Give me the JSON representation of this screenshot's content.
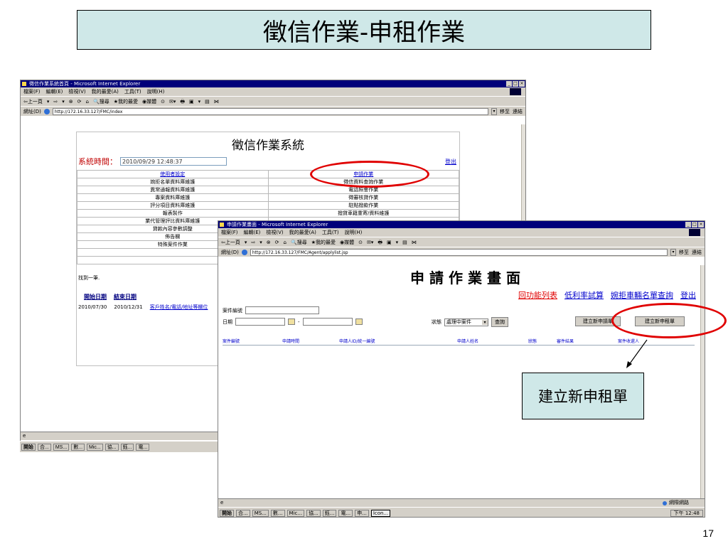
{
  "slide": {
    "title": "徵信作業-申租作業",
    "callout": "建立新申租單",
    "page_number": "17"
  },
  "back_window": {
    "title": "徵信作業系統首頁 - Microsoft Internet Explorer",
    "menu": [
      "檔案(F)",
      "編輯(E)",
      "檢視(V)",
      "我的最愛(A)",
      "工具(T)",
      "說明(H)"
    ],
    "toolbar": [
      "⇦上一頁",
      "▾",
      "⇨",
      "▾",
      "⊗",
      "⟳",
      "⌂",
      "🔍搜尋",
      "★我的最愛",
      "◉媒體",
      "⊙",
      "✉▾",
      "🖶",
      "▣",
      "▾",
      "▤",
      "⋈"
    ],
    "address_label": "網址(D)",
    "address": "http://172.16.33.127/FMC/index",
    "go_label": "移至",
    "links_label": "連結",
    "system_title": "徵信作業系統",
    "system_time_label": "系統時間：",
    "system_time_value": "2010/09/29 12:48:37",
    "logout": "登出",
    "menu_left": [
      "使用者設定",
      "婉拒名單資料庫維護",
      "異常通報資料庫維護",
      "專案資料庫維護",
      "評分項目資料庫維護",
      "報表製作",
      "業代管理評比資料庫維護",
      "貸款內容參數調整",
      "佈告欄",
      "特殊案件作業"
    ],
    "menu_right": [
      "申請作業",
      "徵信資料查詢作業",
      "電話照會作業",
      "徵審核貸作業",
      "駐點撥款作業",
      "撥貸車籍重寄/資料維護"
    ],
    "found_text": "找到一筆.",
    "date_start_header": "開始日期",
    "date_end_header": "結束日期",
    "date_start_value": "2010/07/30",
    "date_end_value": "2010/12/31",
    "customer_link": "客戶姓名/電話/地址等欄位",
    "status_icon": "e",
    "taskbar": [
      "開始",
      "合...",
      "MS...",
      "數...",
      "Mic...",
      "協...",
      "鈺...",
      "電..."
    ]
  },
  "front_window": {
    "title": "申請作業畫面 - Microsoft Internet Explorer",
    "menu": [
      "檔案(F)",
      "編輯(E)",
      "檢視(V)",
      "我的最愛(A)",
      "工具(T)",
      "說明(H)"
    ],
    "toolbar": [
      "⇦上一頁",
      "▾",
      "⇨",
      "▾",
      "⊗",
      "⟳",
      "⌂",
      "🔍搜尋",
      "★我的最愛",
      "◉媒體",
      "⊙",
      "✉▾",
      "🖶",
      "▣",
      "▾",
      "▤",
      "⋈"
    ],
    "address_label": "網址(D)",
    "address": "http://172.16.33.127/FMC/Agent/applylist.jsp",
    "go_label": "移至",
    "links_label": "連結",
    "page_title": "申請作業畫面",
    "nav_links": [
      "回功能列表",
      "低利率試算",
      "婉拒車輛名單查詢",
      "登出"
    ],
    "case_no_label": "案件編號",
    "date_label": "日期",
    "status_label": "狀態",
    "status_value": "處理中案件",
    "query_button": "查詢",
    "new_apply_button": "建立新申請單",
    "new_rent_button": "建立新申租單",
    "columns": [
      "案件編號",
      "申請時間",
      "申請人ID/統一編號",
      "申請人姓名",
      "狀態",
      "審件結果",
      "案件收還人"
    ],
    "status_icon": "e",
    "status_zone": "網際網路",
    "taskbar": [
      "開始",
      "合...",
      "MS...",
      "數...",
      "Mic...",
      "協...",
      "鈺...",
      "電...",
      "申...",
      "Icon..."
    ],
    "clock": "下午 12:48"
  },
  "colors": {
    "title_bg": "#cfe8e8",
    "ie_titlebar": "#00007a",
    "highlight_red": "#e00000",
    "link_blue": "#0000cc",
    "front_nav_link": "#0000cc"
  }
}
